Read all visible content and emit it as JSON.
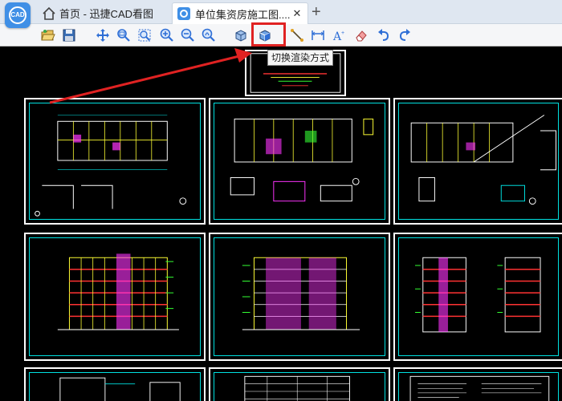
{
  "app": {
    "logo_text": "CAD"
  },
  "tabs": [
    {
      "label": "首页 - 迅捷CAD看图"
    },
    {
      "label": "单位集资房施工图....",
      "close": "✕"
    }
  ],
  "new_tab": "+",
  "tooltip": "切换渲染方式",
  "colors": {
    "accent": "#3f8fe6",
    "highlight": "#e02222",
    "cad_cyan": "#00e0e0",
    "cad_yellow": "#ffff33",
    "cad_magenta": "#ff33ff",
    "cad_green": "#33ff33",
    "cad_red": "#ff3333"
  },
  "toolbar_icons": [
    "open-icon",
    "save-icon",
    "pan-icon",
    "zoom-window-icon",
    "zoom-extents-icon",
    "zoom-in-icon",
    "zoom-out-icon",
    "zoom-realtime-icon",
    "3d-view-icon",
    "render-mode-icon",
    "measure-line-icon",
    "dimension-icon",
    "text-icon",
    "eraser-icon",
    "undo-icon",
    "redo-icon"
  ]
}
